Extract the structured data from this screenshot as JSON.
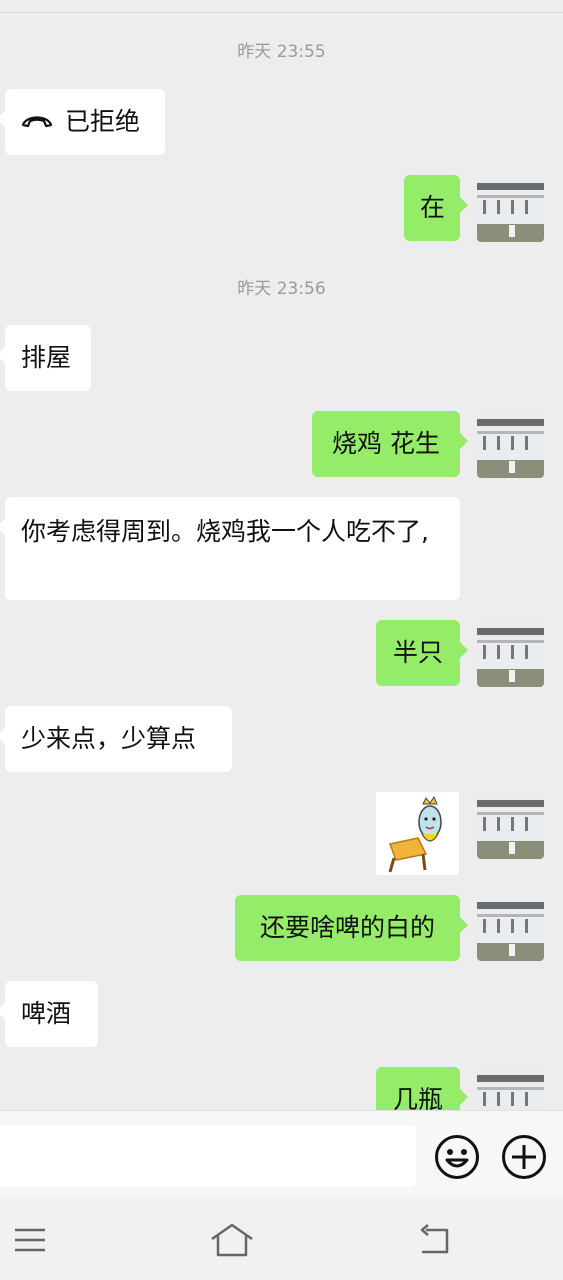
{
  "chat": {
    "messages": [
      {
        "type": "timestamp",
        "text": "昨天 23:55"
      },
      {
        "type": "call",
        "side": "in",
        "icon": "declined-call-icon",
        "text": "已拒绝"
      },
      {
        "type": "text",
        "side": "out",
        "text": "在"
      },
      {
        "type": "timestamp",
        "text": "昨天 23:56"
      },
      {
        "type": "text",
        "side": "in",
        "text": "排屋"
      },
      {
        "type": "text",
        "side": "out",
        "text": "烧鸡 花生"
      },
      {
        "type": "text",
        "side": "in",
        "text": "你考虑得周到。烧鸡我一个人吃不了,"
      },
      {
        "type": "text",
        "side": "out",
        "text": "半只"
      },
      {
        "type": "text",
        "side": "in",
        "text": "少来点，少算点"
      },
      {
        "type": "sticker",
        "side": "out",
        "icon": "cartoon-sticker-icon"
      },
      {
        "type": "text",
        "side": "out",
        "text": "还要啥啤的白的"
      },
      {
        "type": "text",
        "side": "in",
        "text": "啤酒"
      },
      {
        "type": "text",
        "side": "out",
        "text": "几瓶"
      }
    ]
  },
  "input_bar": {
    "text_value": "",
    "emoji_icon": "emoji-icon",
    "plus_icon": "plus-icon"
  },
  "system_nav": {
    "menu_icon": "menu-icon",
    "home_icon": "home-icon",
    "back_icon": "back-icon"
  },
  "colors": {
    "background": "#ededed",
    "outgoing_bubble": "#95ec69",
    "incoming_bubble": "#ffffff",
    "timestamp": "#9a9a9a"
  }
}
